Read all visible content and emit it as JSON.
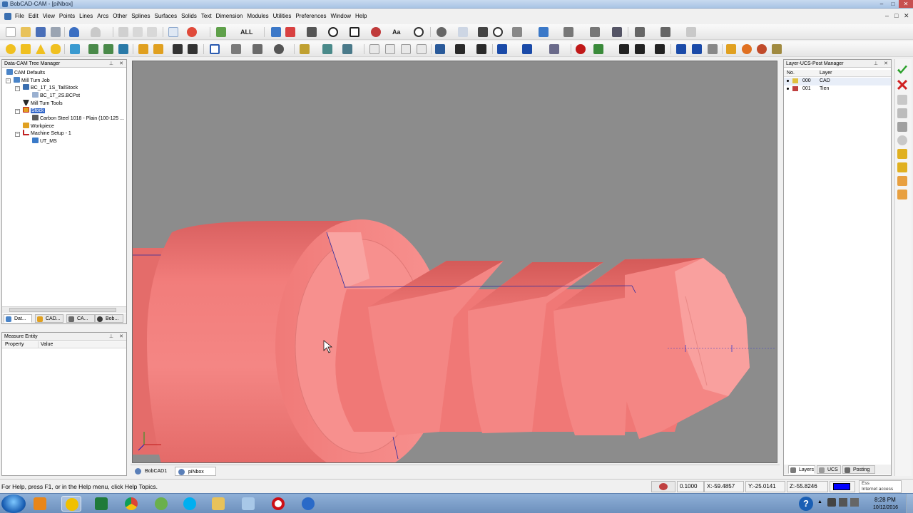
{
  "window": {
    "title": "BobCAD-CAM - [piNbox]",
    "controls": [
      "–",
      "□",
      "✕"
    ]
  },
  "menu": {
    "items": [
      "File",
      "Edit",
      "View",
      "Points",
      "Lines",
      "Arcs",
      "Other",
      "Splines",
      "Surfaces",
      "Solids",
      "Text",
      "Dimension",
      "Modules",
      "Utilities",
      "Preferences",
      "Window",
      "Help"
    ],
    "mdi_controls": [
      "–",
      "□",
      "✕"
    ]
  },
  "toolbar": {
    "all_label": "ALL",
    "text_label": "Aa"
  },
  "tree_panel": {
    "title": "Data-CAM Tree Manager",
    "items": [
      {
        "label": "CAM Defaults",
        "icon": "folder-icon"
      },
      {
        "label": "Mill Turn Job",
        "icon": "job-icon"
      },
      {
        "label": "BC_1T_1S_TailStock",
        "icon": "machine-icon"
      },
      {
        "label": "BC_1T_2S.BCPst",
        "icon": "post-icon"
      },
      {
        "label": "Mill Turn Tools",
        "icon": "tools-icon"
      },
      {
        "label": "Stock",
        "icon": "stock-icon"
      },
      {
        "label": "Carbon Steel 1018 - Plain (100-125 ...",
        "icon": "material-icon"
      },
      {
        "label": "Workpiece",
        "icon": "workpiece-icon"
      },
      {
        "label": "Machine Setup - 1",
        "icon": "setup-icon"
      },
      {
        "label": "UT_MS",
        "icon": "ucs-icon"
      }
    ],
    "tabs": [
      "Dat...",
      "CAD...",
      "CA...",
      "Bob..."
    ]
  },
  "measure_panel": {
    "title": "Measure Entity",
    "columns": [
      "Property",
      "Value"
    ]
  },
  "doc_tabs": [
    "BobCAD1",
    "piNbox"
  ],
  "layer_panel": {
    "title": "Layer-UCS-Post Manager",
    "columns": [
      "No.",
      "Layer"
    ],
    "rows": [
      {
        "no": "000",
        "layer": "CAD"
      },
      {
        "no": "001",
        "layer": "Tien"
      }
    ],
    "tabs": [
      "Layers",
      "UCS",
      "Posting"
    ]
  },
  "statusbar": {
    "help_text": "For Help, press F1, or in the Help menu, click Help Topics.",
    "grid_value": "0.1000",
    "x": "X:-59.4857",
    "y": "Y:-25.0141",
    "z": "Z:-55.8246",
    "color_swatch": "#0000ff",
    "network_line1": "Ess",
    "network_line2": "Internet access"
  },
  "taskbar": {
    "time": "8:28 PM",
    "date": "10/12/2016"
  },
  "colors": {
    "solid": "#f27d7b",
    "viewport_bg": "#8c8c8c",
    "selection": "#3165c8"
  }
}
